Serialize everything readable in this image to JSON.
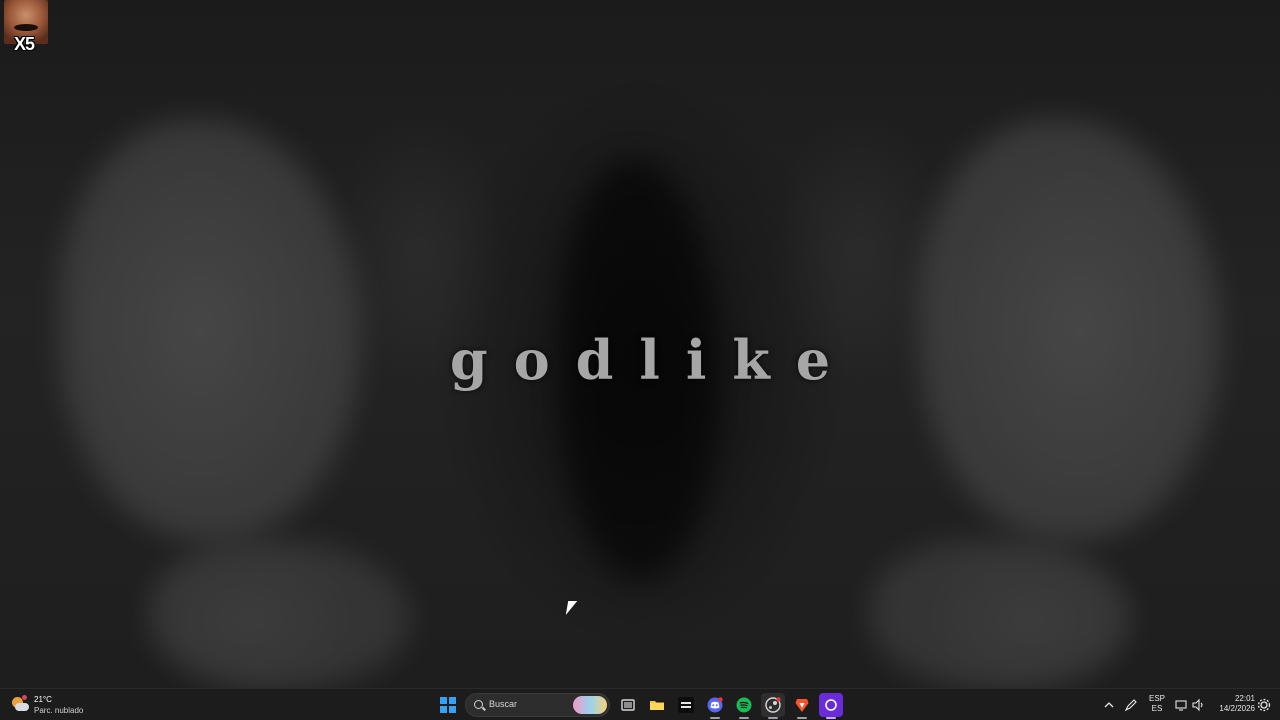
{
  "desktop": {
    "wallpaper_text": "godlike",
    "icons": [
      {
        "label": "X5",
        "icon": "meme-face-icon"
      }
    ]
  },
  "taskbar": {
    "weather": {
      "temperature": "21°C",
      "condition": "Parc. nublado",
      "icon": "partly-cloudy-icon"
    },
    "start_icon": "windows-start-icon",
    "search": {
      "placeholder": "Buscar",
      "icon": "search-icon"
    },
    "pinned_apps": [
      {
        "name": "task-view",
        "icon": "task-view-icon"
      },
      {
        "name": "file-explorer",
        "icon": "folder-icon"
      },
      {
        "name": "call-of-duty",
        "icon": "game-icon"
      },
      {
        "name": "discord",
        "icon": "discord-icon",
        "color": "#5865F2"
      },
      {
        "name": "spotify",
        "icon": "spotify-icon",
        "color": "#1DB954"
      },
      {
        "name": "steam",
        "icon": "steam-icon"
      },
      {
        "name": "brave",
        "icon": "brave-lion-icon",
        "color": "#FB542B"
      },
      {
        "name": "app-purple",
        "icon": "circle-app-icon",
        "color": "#8a3ffc"
      }
    ],
    "tray": {
      "overflow_icon": "chevron-up-icon",
      "pen_icon": "pen-icon",
      "language": {
        "line1": "ESP",
        "line2": "ES"
      },
      "network_icon": "network-icon",
      "volume_icon": "speaker-icon",
      "clock": {
        "time": "22:01",
        "date": "14/2/2026"
      },
      "notification_icon": "settings-gear-icon"
    }
  }
}
